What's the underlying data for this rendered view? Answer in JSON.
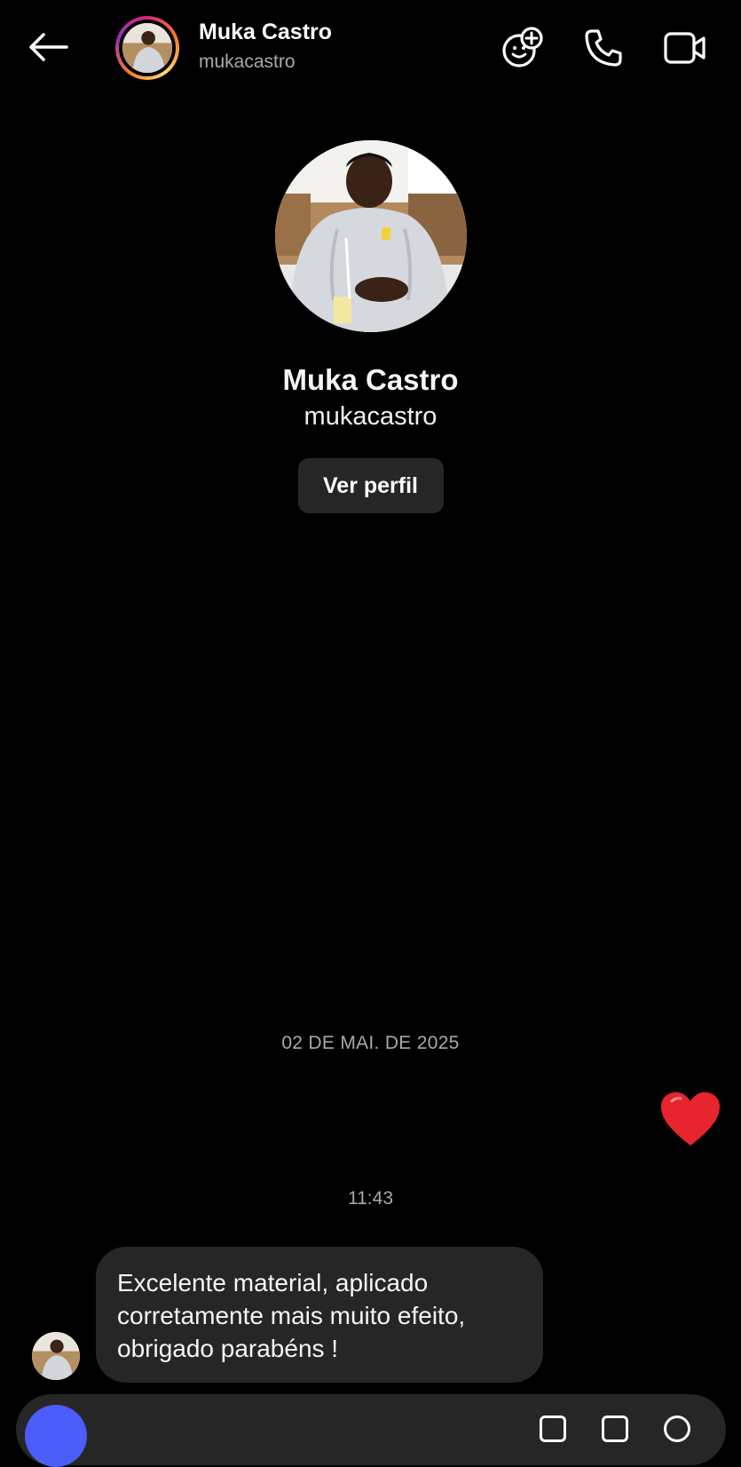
{
  "header": {
    "title": "Muka Castro",
    "subtitle": "mukacastro",
    "icons": [
      "back-arrow-icon",
      "add-sticker-icon",
      "phone-icon",
      "video-camera-icon"
    ]
  },
  "profile": {
    "name": "Muka Castro",
    "handle": "mukacastro",
    "view_profile_label": "Ver perfil"
  },
  "thread": {
    "date_separator": "02 DE MAI. DE 2025",
    "sent_reaction": "heart",
    "time_separator": "11:43",
    "received_message": "Excelente material, aplicado corretamente mais muito efeito, obrigado parabéns !"
  },
  "colors": {
    "background": "#000000",
    "bubble": "#262626",
    "muted_text": "#a8a8a8",
    "heart": "#e8242f",
    "camera_button": "#4a5df9"
  }
}
